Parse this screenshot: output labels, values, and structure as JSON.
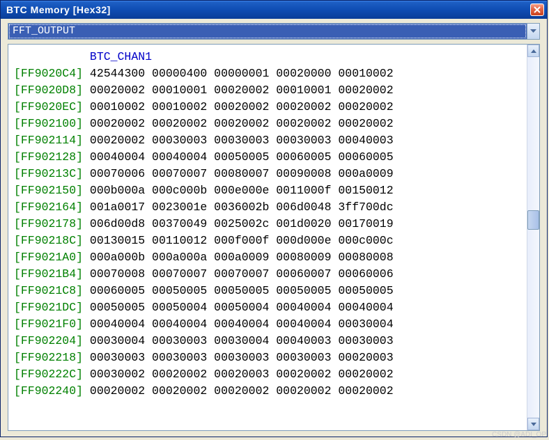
{
  "window": {
    "title": "BTC Memory [Hex32]"
  },
  "dropdown": {
    "value": "FFT_OUTPUT"
  },
  "channel_label": "BTC_CHAN1",
  "rows": [
    {
      "addr": "FF9020C4",
      "vals": [
        "42544300",
        "00000400",
        "00000001",
        "00020000",
        "00010002"
      ]
    },
    {
      "addr": "FF9020D8",
      "vals": [
        "00020002",
        "00010001",
        "00020002",
        "00010001",
        "00020002"
      ]
    },
    {
      "addr": "FF9020EC",
      "vals": [
        "00010002",
        "00010002",
        "00020002",
        "00020002",
        "00020002"
      ]
    },
    {
      "addr": "FF902100",
      "vals": [
        "00020002",
        "00020002",
        "00020002",
        "00020002",
        "00020002"
      ]
    },
    {
      "addr": "FF902114",
      "vals": [
        "00020002",
        "00030003",
        "00030003",
        "00030003",
        "00040003"
      ]
    },
    {
      "addr": "FF902128",
      "vals": [
        "00040004",
        "00040004",
        "00050005",
        "00060005",
        "00060005"
      ]
    },
    {
      "addr": "FF90213C",
      "vals": [
        "00070006",
        "00070007",
        "00080007",
        "00090008",
        "000a0009"
      ]
    },
    {
      "addr": "FF902150",
      "vals": [
        "000b000a",
        "000c000b",
        "000e000e",
        "0011000f",
        "00150012"
      ]
    },
    {
      "addr": "FF902164",
      "vals": [
        "001a0017",
        "0023001e",
        "0036002b",
        "006d0048",
        "3ff700dc"
      ]
    },
    {
      "addr": "FF902178",
      "vals": [
        "006d00d8",
        "00370049",
        "0025002c",
        "001d0020",
        "00170019"
      ]
    },
    {
      "addr": "FF90218C",
      "vals": [
        "00130015",
        "00110012",
        "000f000f",
        "000d000e",
        "000c000c"
      ]
    },
    {
      "addr": "FF9021A0",
      "vals": [
        "000a000b",
        "000a000a",
        "000a0009",
        "00080009",
        "00080008"
      ]
    },
    {
      "addr": "FF9021B4",
      "vals": [
        "00070008",
        "00070007",
        "00070007",
        "00060007",
        "00060006"
      ]
    },
    {
      "addr": "FF9021C8",
      "vals": [
        "00060005",
        "00050005",
        "00050005",
        "00050005",
        "00050005"
      ]
    },
    {
      "addr": "FF9021DC",
      "vals": [
        "00050005",
        "00050004",
        "00050004",
        "00040004",
        "00040004"
      ]
    },
    {
      "addr": "FF9021F0",
      "vals": [
        "00040004",
        "00040004",
        "00040004",
        "00040004",
        "00030004"
      ]
    },
    {
      "addr": "FF902204",
      "vals": [
        "00030004",
        "00030003",
        "00030004",
        "00040003",
        "00030003"
      ]
    },
    {
      "addr": "FF902218",
      "vals": [
        "00030003",
        "00030003",
        "00030003",
        "00030003",
        "00020003"
      ]
    },
    {
      "addr": "FF90222C",
      "vals": [
        "00030002",
        "00020002",
        "00020003",
        "00020002",
        "00020002"
      ]
    },
    {
      "addr": "FF902240",
      "vals": [
        "00020002",
        "00020002",
        "00020002",
        "00020002",
        "00020002"
      ]
    }
  ],
  "watermark": "CSDN @ADI_OP"
}
